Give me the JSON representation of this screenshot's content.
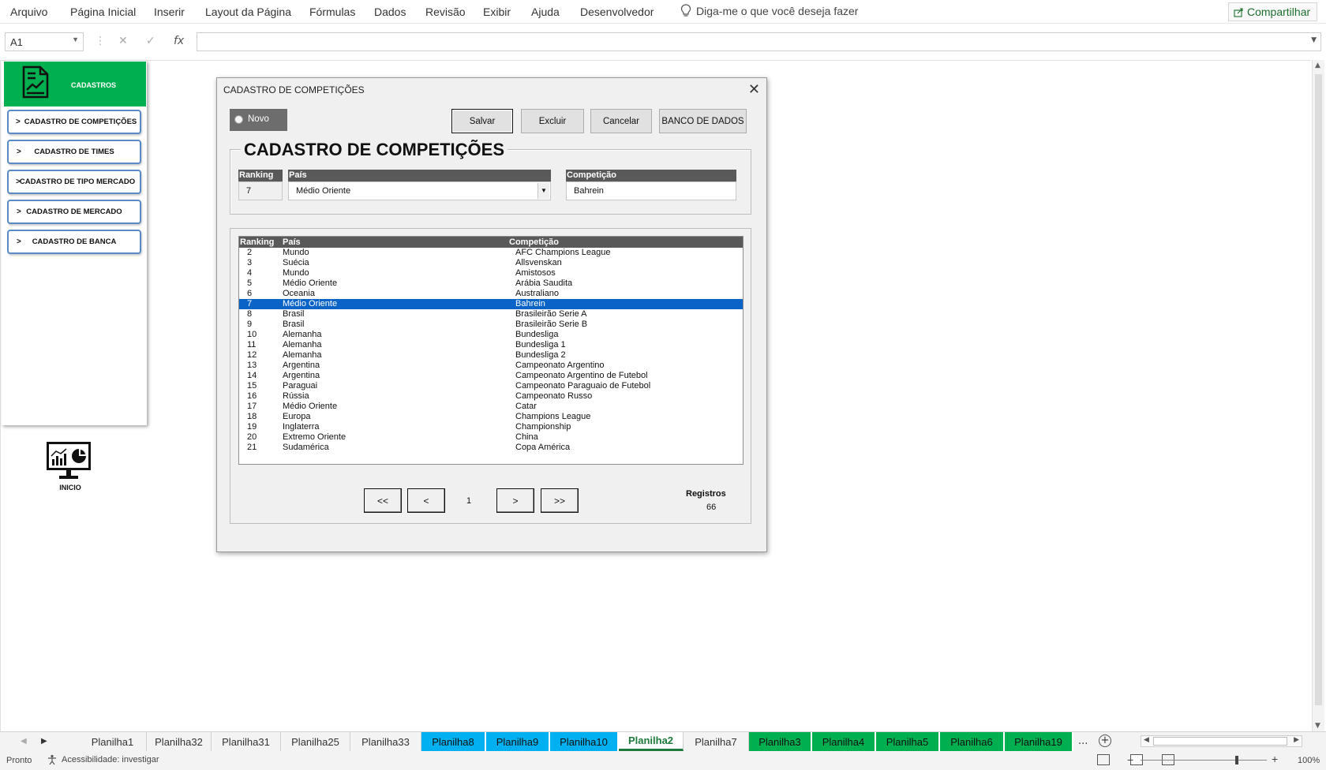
{
  "menu": {
    "items": [
      "Arquivo",
      "Página Inicial",
      "Inserir",
      "Layout da Página",
      "Fórmulas",
      "Dados",
      "Revisão",
      "Exibir",
      "Ajuda",
      "Desenvolvedor"
    ],
    "tell_me": "Diga-me o que você deseja fazer",
    "share": "Compartilhar"
  },
  "formula_bar": {
    "name_box": "A1",
    "fx": "fx",
    "content": ""
  },
  "left_panel": {
    "header": "CADASTROS",
    "buttons": [
      {
        "chev": ">",
        "label": "CADASTRO DE COMPETIÇÕES"
      },
      {
        "chev": ">",
        "label": "CADASTRO DE TIMES"
      },
      {
        "chev": ">",
        "label": "CADASTRO DE TIPO MERCADO"
      },
      {
        "chev": ">",
        "label": "CADASTRO DE MERCADO"
      },
      {
        "chev": ">",
        "label": "CADASTRO DE BANCA"
      }
    ],
    "home_label": "INICIO"
  },
  "dialog": {
    "title": "CADASTRO DE COMPETIÇÕES",
    "close": "✕",
    "novo": "Novo",
    "buttons": {
      "salvar": "Salvar",
      "excluir": "Excluir",
      "cancelar": "Cancelar",
      "banco": "BANCO DE DADOS"
    },
    "form_title": "CADASTRO DE COMPETIÇÕES",
    "fields": {
      "ranking_label": "Ranking",
      "ranking_value": "7",
      "pais_label": "País",
      "pais_value": "Médio Oriente",
      "competicao_label": "Competição",
      "competicao_value": "Bahrein"
    },
    "list": {
      "headers": {
        "ranking": "Ranking",
        "pais": "País",
        "competicao": "Competição"
      },
      "selected_index": 5,
      "rows": [
        {
          "ranking": "2",
          "pais": "Mundo",
          "competicao": "AFC Champions League"
        },
        {
          "ranking": "3",
          "pais": "Suécia",
          "competicao": "Allsvenskan"
        },
        {
          "ranking": "4",
          "pais": "Mundo",
          "competicao": "Amistosos"
        },
        {
          "ranking": "5",
          "pais": "Médio Oriente",
          "competicao": "Arábia Saudita"
        },
        {
          "ranking": "6",
          "pais": "Oceania",
          "competicao": "Australiano"
        },
        {
          "ranking": "7",
          "pais": "Médio Oriente",
          "competicao": "Bahrein"
        },
        {
          "ranking": "8",
          "pais": "Brasil",
          "competicao": "Brasileirão Serie A"
        },
        {
          "ranking": "9",
          "pais": "Brasil",
          "competicao": "Brasileirão Serie B"
        },
        {
          "ranking": "10",
          "pais": "Alemanha",
          "competicao": "Bundesliga"
        },
        {
          "ranking": "11",
          "pais": "Alemanha",
          "competicao": "Bundesliga 1"
        },
        {
          "ranking": "12",
          "pais": "Alemanha",
          "competicao": "Bundesliga 2"
        },
        {
          "ranking": "13",
          "pais": "Argentina",
          "competicao": "Campeonato Argentino"
        },
        {
          "ranking": "14",
          "pais": "Argentina",
          "competicao": "Campeonato Argentino de Futebol"
        },
        {
          "ranking": "15",
          "pais": "Paraguai",
          "competicao": "Campeonato Paraguaio de Futebol"
        },
        {
          "ranking": "16",
          "pais": "Rússia",
          "competicao": "Campeonato Russo"
        },
        {
          "ranking": "17",
          "pais": "Médio Oriente",
          "competicao": "Catar"
        },
        {
          "ranking": "18",
          "pais": "Europa",
          "competicao": "Champions League"
        },
        {
          "ranking": "19",
          "pais": "Inglaterra",
          "competicao": "Championship"
        },
        {
          "ranking": "20",
          "pais": "Extremo Oriente",
          "competicao": "China"
        },
        {
          "ranking": "21",
          "pais": "Sudamérica",
          "competicao": "Copa América"
        }
      ]
    },
    "pager": {
      "first": "<<",
      "prev": "<",
      "page": "1",
      "next": ">",
      "last": ">>"
    },
    "registros_label": "Registros",
    "registros_value": "66"
  },
  "tabs": [
    {
      "label": "Planilha1",
      "color": "none"
    },
    {
      "label": "Planilha32",
      "color": "none"
    },
    {
      "label": "Planilha31",
      "color": "none"
    },
    {
      "label": "Planilha25",
      "color": "none"
    },
    {
      "label": "Planilha33",
      "color": "none"
    },
    {
      "label": "Planilha8",
      "color": "#00b0f0"
    },
    {
      "label": "Planilha9",
      "color": "#00b0f0"
    },
    {
      "label": "Planilha10",
      "color": "#00b0f0"
    },
    {
      "label": "Planilha2",
      "color": "active"
    },
    {
      "label": "Planilha7",
      "color": "none"
    },
    {
      "label": "Planilha3",
      "color": "#00b050"
    },
    {
      "label": "Planilha4",
      "color": "#00b050"
    },
    {
      "label": "Planilha5",
      "color": "#00b050"
    },
    {
      "label": "Planilha6",
      "color": "#00b050"
    },
    {
      "label": "Planilha19",
      "color": "#00b050"
    }
  ],
  "tabs_more": "...",
  "status": {
    "ready": "Pronto",
    "accessibility": "Acessibilidade: investigar",
    "zoom": "100%"
  },
  "colors": {
    "green": "#00b050",
    "blue": "#00b0f0",
    "selection": "#0a64c8",
    "header_gray": "#595959"
  }
}
